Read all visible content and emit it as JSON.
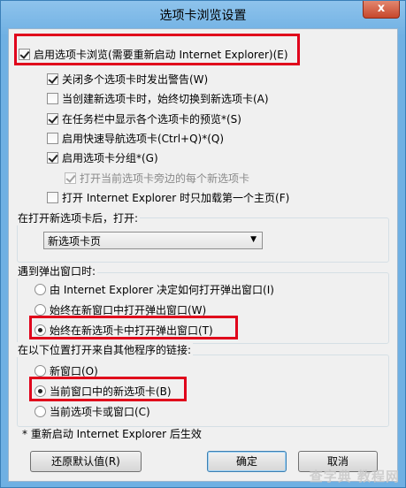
{
  "window": {
    "title": "选项卡浏览设置",
    "close_label": "x"
  },
  "options": {
    "enable_tabs": "启用选项卡浏览(需要重新启动 Internet Explorer)(E)",
    "warn_close": "关闭多个选项卡时发出警告(W)",
    "switch_new": "当创建新选项卡时，始终切换到新选项卡(A)",
    "taskbar_preview": "在任务栏中显示各个选项卡的预览*(S)",
    "quick_tabs": "启用快速导航选项卡(Ctrl+Q)*(Q)",
    "tab_groups": "启用选项卡分组*(G)",
    "open_beside": "打开当前选项卡旁边的每个新选项卡",
    "first_home": "打开 Internet Explorer 时只加载第一个主页(F)"
  },
  "new_tab": {
    "label": "在打开新选项卡后，打开:",
    "selected": "新选项卡页"
  },
  "popups": {
    "label": "遇到弹出窗口时:",
    "opt1": "由 Internet Explorer 决定如何打开弹出窗口(I)",
    "opt2": "始终在新窗口中打开弹出窗口(W)",
    "opt3": "始终在新选项卡中打开弹出窗口(T)"
  },
  "links": {
    "label": "在以下位置打开来自其他程序的链接:",
    "opt1": "新窗口(O)",
    "opt2": "当前窗口中的新选项卡(B)",
    "opt3": "当前选项卡或窗口(C)"
  },
  "footnote": "* 重新启动 Internet Explorer 后生效",
  "buttons": {
    "restore": "还原默认值(R)",
    "ok": "确定",
    "cancel": "取消"
  },
  "watermark": "查字典 教程网",
  "colors": {
    "highlight": "#e0001b",
    "window_frame": "#6fb0e3"
  }
}
